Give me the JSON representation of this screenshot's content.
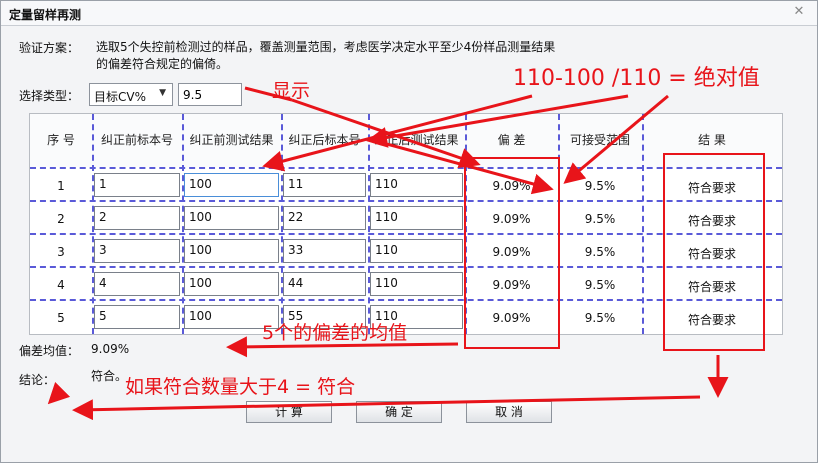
{
  "window": {
    "title": "定量留样再测"
  },
  "scheme": {
    "label": "验证方案：",
    "text": "选取5个失控前检测过的样品，覆盖测量范围，考虑医学决定水平至少4份样品测量结果的偏差符合规定的偏倚。"
  },
  "type_select": {
    "label": "选择类型：",
    "value": "目标CV%",
    "input_value": "9.5"
  },
  "table": {
    "headers": [
      "序 号",
      "纠正前标本号",
      "纠正前测试结果",
      "纠正后标本号",
      "纠正后测试结果",
      "偏 差",
      "可接受范围",
      "结 果"
    ],
    "rows": [
      {
        "index": "1",
        "pre_sample": "1",
        "pre_result": "100",
        "post_sample": "11",
        "post_result": "110",
        "bias": "9.09%",
        "range": "9.5%",
        "result": "符合要求"
      },
      {
        "index": "2",
        "pre_sample": "2",
        "pre_result": "100",
        "post_sample": "22",
        "post_result": "110",
        "bias": "9.09%",
        "range": "9.5%",
        "result": "符合要求"
      },
      {
        "index": "3",
        "pre_sample": "3",
        "pre_result": "100",
        "post_sample": "33",
        "post_result": "110",
        "bias": "9.09%",
        "range": "9.5%",
        "result": "符合要求"
      },
      {
        "index": "4",
        "pre_sample": "4",
        "pre_result": "100",
        "post_sample": "44",
        "post_result": "110",
        "bias": "9.09%",
        "range": "9.5%",
        "result": "符合要求"
      },
      {
        "index": "5",
        "pre_sample": "5",
        "pre_result": "100",
        "post_sample": "55",
        "post_result": "110",
        "bias": "9.09%",
        "range": "9.5%",
        "result": "符合要求"
      }
    ]
  },
  "summary": {
    "bias_avg_label": "偏差均值：",
    "bias_avg_value": "9.09%",
    "conclusion_label": "结论：",
    "conclusion_value": "符合。"
  },
  "buttons": {
    "calc": "计 算",
    "ok": "确 定",
    "cancel": "取 消"
  },
  "annotations": {
    "display": "显示",
    "formula": "110-100 /110 = 绝对值",
    "mean_bias": "5个的偏差的均值",
    "rule": "如果符合数量大于4 = 符合",
    "color": "#e8141a"
  }
}
